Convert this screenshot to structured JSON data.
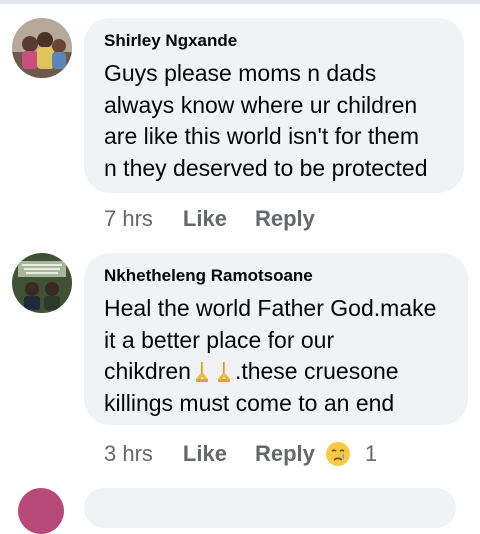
{
  "comments": [
    {
      "author": "Shirley Ngxande",
      "text": "Guys please moms n dads\nalways know where ur children\nare like this world isn't for them\nn they deserved to be protected",
      "time": "7 hrs",
      "like_label": "Like",
      "reply_label": "Reply"
    },
    {
      "author": "Nkhetheleng Ramotsoane",
      "text_line1": "Heal the world Father God.make",
      "text_line2": "it a better place for our",
      "text_line3_start": "chikdren",
      "text_line3_end": ".these cruesone",
      "text_line4": "killings must come to an end",
      "time": "3 hrs",
      "like_label": "Like",
      "reply_label": "Reply",
      "reaction_count": "1",
      "reaction_icon": "crying-face-icon"
    }
  ],
  "colors": {
    "bubble": "#f0f2f5",
    "secondary_text": "#65676b",
    "primary_text": "#050505"
  }
}
